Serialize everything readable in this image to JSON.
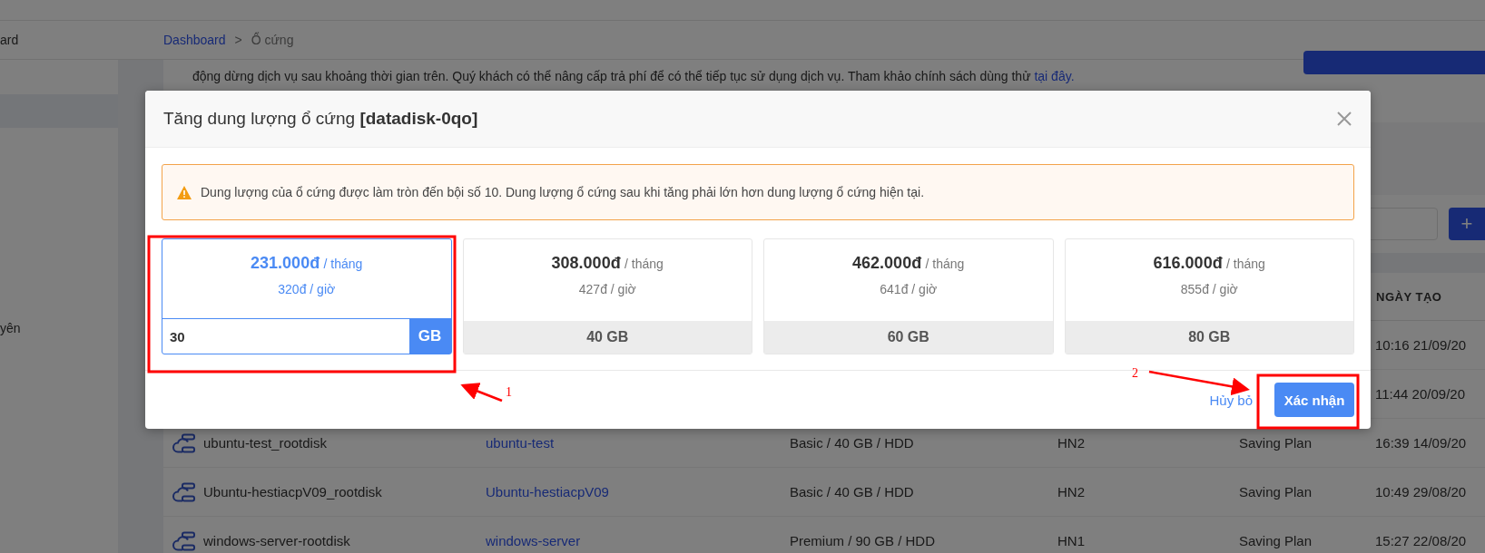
{
  "sidebar": {
    "items": [
      {
        "label": "ard"
      },
      {
        "label": "yên"
      }
    ]
  },
  "breadcrumb": {
    "items": [
      {
        "label": "Dashboard",
        "kind": "link"
      },
      {
        "label": "Ổ cứng",
        "kind": "current"
      }
    ],
    "separator": ">"
  },
  "notice": {
    "text": "động dừng dịch vụ sau khoảng thời gian trên. Quý khách có thể nâng cấp trả phí để có thể tiếp tục sử dụng dịch vụ. Tham khảo chính sách dùng thử",
    "link": "tại đây."
  },
  "toolbar": {
    "add_button": "+"
  },
  "table": {
    "columns": [
      {
        "label": "NGÀY TẠO"
      }
    ],
    "rows": [
      {
        "date": "10:16 21/09/20"
      },
      {
        "date": "11:44 20/09/20"
      },
      {
        "name": "ubuntu-test_rootdisk",
        "instance": "ubuntu-test",
        "type": "Basic / 40 GB / HDD",
        "region": "HN2",
        "plan": "Saving Plan",
        "date": "16:39 14/09/20"
      },
      {
        "name": "Ubuntu-hestiacpV09_rootdisk",
        "instance": "Ubuntu-hestiacpV09",
        "type": "Basic / 40 GB / HDD",
        "region": "HN2",
        "plan": "Saving Plan",
        "date": "10:49 29/08/20"
      },
      {
        "name": "windows-server-rootdisk",
        "instance": "windows-server",
        "type": "Premium / 90 GB / HDD",
        "region": "HN1",
        "plan": "Saving Plan",
        "date": "15:27 22/08/20"
      }
    ]
  },
  "modal": {
    "title": "Tăng dung lượng ổ cứng **[datadisk-0qo]**",
    "alert": "Dung lượng của ổ cứng được làm tròn đến bội số 10. Dung lượng ổ cứng sau khi tăng phải lớn hơn dung lượng ổ cứng hiện tại.",
    "plans": [
      {
        "price": "231.000đ",
        "period": "/ tháng",
        "hourly": "320đ / giờ",
        "size": "30",
        "unit": "GB",
        "selected": true
      },
      {
        "price": "308.000đ",
        "period": "/ tháng",
        "hourly": "427đ / giờ",
        "size": "40 GB",
        "selected": false
      },
      {
        "price": "462.000đ",
        "period": "/ tháng",
        "hourly": "641đ / giờ",
        "size": "60 GB",
        "selected": false
      },
      {
        "price": "616.000đ",
        "period": "/ tháng",
        "hourly": "855đ / giờ",
        "size": "80 GB",
        "selected": false
      }
    ],
    "cancel": "Hủy bỏ",
    "confirm": "Xác nhận"
  },
  "annotations": [
    {
      "label": "1"
    },
    {
      "label": "2"
    }
  ]
}
